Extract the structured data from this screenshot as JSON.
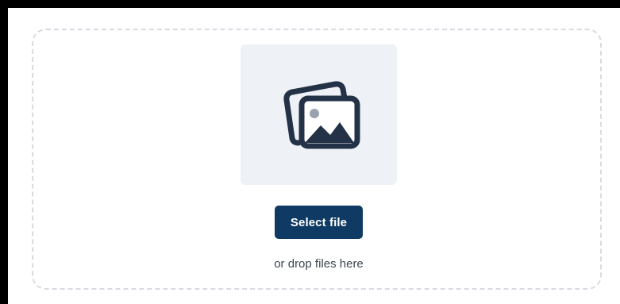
{
  "uploader": {
    "icon": "images-icon",
    "select_button_label": "Select file",
    "drop_hint": "or drop files here"
  },
  "colors": {
    "button_bg": "#0f3a63",
    "tile_bg": "#eef2f6",
    "dashed_border": "#d7dbe1",
    "icon_fill": "#243247"
  }
}
